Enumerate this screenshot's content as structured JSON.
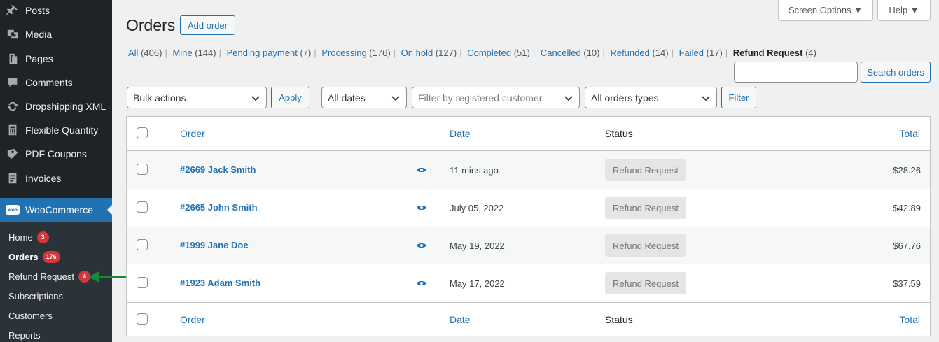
{
  "sidebar": {
    "items": [
      {
        "label": "Posts",
        "icon": "pin-icon"
      },
      {
        "label": "Media",
        "icon": "media-icon"
      },
      {
        "label": "Pages",
        "icon": "pages-icon"
      },
      {
        "label": "Comments",
        "icon": "comments-icon"
      },
      {
        "label": "Dropshipping XML",
        "icon": "sync-icon"
      },
      {
        "label": "Flexible Quantity",
        "icon": "calculator-icon"
      },
      {
        "label": "PDF Coupons",
        "icon": "coupons-icon"
      },
      {
        "label": "Invoices",
        "icon": "invoice-icon"
      }
    ],
    "woocommerce": {
      "label": "WooCommerce",
      "logo_text": "woo"
    },
    "submenu": [
      {
        "label": "Home",
        "badge": "3"
      },
      {
        "label": "Orders",
        "badge": "176"
      },
      {
        "label": "Refund Request",
        "badge": "4"
      },
      {
        "label": "Subscriptions",
        "badge": ""
      },
      {
        "label": "Customers",
        "badge": ""
      },
      {
        "label": "Reports",
        "badge": ""
      }
    ]
  },
  "header": {
    "screen_options": "Screen Options ▼",
    "help": "Help ▼",
    "title": "Orders",
    "add_order": "Add order"
  },
  "views": [
    {
      "label": "All",
      "count": "(406)"
    },
    {
      "label": "Mine",
      "count": "(144)"
    },
    {
      "label": "Pending payment",
      "count": "(7)"
    },
    {
      "label": "Processing",
      "count": "(176)"
    },
    {
      "label": "On hold",
      "count": "(127)"
    },
    {
      "label": "Completed",
      "count": "(51)"
    },
    {
      "label": "Cancelled",
      "count": "(10)"
    },
    {
      "label": "Refunded",
      "count": "(14)"
    },
    {
      "label": "Failed",
      "count": "(17)"
    },
    {
      "label": "Refund Request",
      "count": "(4)",
      "current": true
    }
  ],
  "search": {
    "placeholder": "",
    "button": "Search orders"
  },
  "filters": {
    "bulk_actions": "Bulk actions",
    "apply": "Apply",
    "dates": "All dates",
    "customer_placeholder": "Filter by registered customer",
    "order_types": "All orders types",
    "filter": "Filter"
  },
  "table": {
    "columns": {
      "order": "Order",
      "date": "Date",
      "status": "Status",
      "total": "Total"
    },
    "rows": [
      {
        "order": "#2669 Jack Smith",
        "date": "11 mins ago",
        "status": "Refund Request",
        "total": "$28.26"
      },
      {
        "order": "#2665 John Smith",
        "date": "July 05, 2022",
        "status": "Refund Request",
        "total": "$42.89"
      },
      {
        "order": "#1999 Jane Doe",
        "date": "May 19, 2022",
        "status": "Refund Request",
        "total": "$67.76"
      },
      {
        "order": "#1923 Adam Smith",
        "date": "May 17, 2022",
        "status": "Refund Request",
        "total": "$37.59"
      }
    ]
  },
  "colors": {
    "accent": "#2271b1",
    "sidebar": "#1d2327",
    "badge": "#d63638",
    "arrow": "#1a8a3a"
  }
}
